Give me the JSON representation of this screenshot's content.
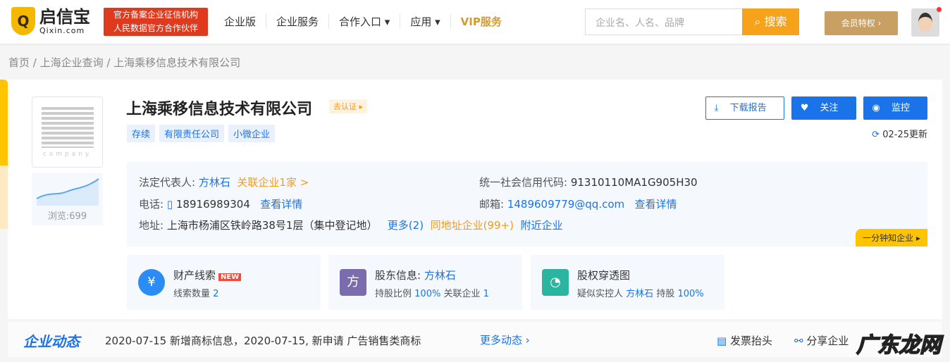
{
  "header": {
    "logo_cn": "启信宝",
    "logo_en": "Qixin.com",
    "badge_line1": "官方备案企业征信机构",
    "badge_line2": "人民数据官方合作伙伴",
    "nav": [
      "企业版",
      "企业服务",
      "合作入口 ▾",
      "应用 ▾"
    ],
    "vip": "VIP服务",
    "search_placeholder": "企业名、人名、品牌",
    "search_button": "搜索",
    "member": "会员特权 ›"
  },
  "breadcrumb": "首页 /  上海企业查询 / 上海乘移信息技术有限公司",
  "company": {
    "name": "上海乘移信息技术有限公司",
    "auth": "去认证 ▸",
    "tags": [
      "存续",
      "有限责任公司",
      "小微企业"
    ],
    "logo_text": "company",
    "views": "浏览:699",
    "actions": {
      "report": "下载报告",
      "follow": "关注",
      "monitor": "监控"
    },
    "updated": "02-25更新"
  },
  "info": {
    "legal_label": "法定代表人:",
    "legal": "方林石",
    "related": "关联企业1家 >",
    "credit_label": "统一社会信用代码:",
    "credit": "91310110MA1G905H30",
    "phone_label": "电话:",
    "phone": "18916989304",
    "view_detail": "查看详情",
    "email_label": "邮箱:",
    "email": "1489609779@qq.com",
    "address_label": "地址:",
    "address": "上海市杨浦区铁岭路38号1层（集中登记地）",
    "more": "更多(2)",
    "same_addr": "同地址企业(99+)",
    "nearby": "附近企业",
    "fast": "一分钟知企业 ▸"
  },
  "boxes": [
    {
      "icon": "¥",
      "title": "财产线索",
      "badge": "NEW",
      "sub_label": "线索数量",
      "sub_value": "2"
    },
    {
      "icon": "方",
      "title": "股东信息:",
      "title_link": "方林石",
      "sub_label": "持股比例",
      "sub_value": "100%",
      "sub_label2": "关联企业",
      "sub_value2": "1"
    },
    {
      "title": "股权穿透图",
      "sub_label": "疑似实控人",
      "sub_value": "方林石",
      "sub_label2": "持股",
      "sub_value2": "100%"
    }
  ],
  "footer": {
    "dynamics": "企业动态",
    "news": "2020-07-15   新增商标信息，2020-07-15, 新申请 广告销售类商标",
    "more": "更多动态  ›",
    "invoice": "发票抬头",
    "share": "分享企业"
  },
  "watermark": "广东龙网"
}
